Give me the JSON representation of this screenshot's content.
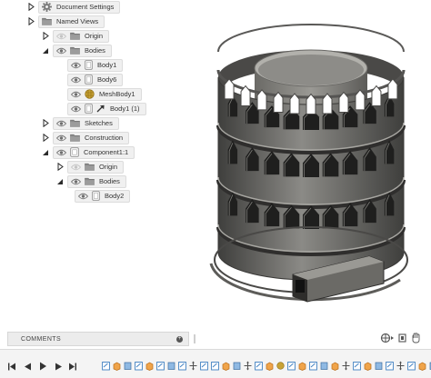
{
  "browser": {
    "rows": [
      {
        "id": "document-settings",
        "label": "Document Settings",
        "indent": 0,
        "expand": "right",
        "icons": [
          "gear"
        ]
      },
      {
        "id": "named-views",
        "label": "Named Views",
        "indent": 0,
        "expand": "right",
        "icons": [
          "folder"
        ]
      },
      {
        "id": "origin",
        "label": "Origin",
        "indent": 1,
        "expand": "right",
        "icons": [
          "eye-off",
          "folder"
        ]
      },
      {
        "id": "bodies",
        "label": "Bodies",
        "indent": 1,
        "expand": "down",
        "icons": [
          "eye",
          "folder"
        ]
      },
      {
        "id": "body1",
        "label": "Body1",
        "indent": 2,
        "expand": "none",
        "icons": [
          "eye",
          "body"
        ]
      },
      {
        "id": "body6",
        "label": "Body6",
        "indent": 2,
        "expand": "none",
        "icons": [
          "eye",
          "body"
        ]
      },
      {
        "id": "meshbody1",
        "label": "MeshBody1",
        "indent": 2,
        "expand": "none",
        "icons": [
          "eye",
          "mesh"
        ]
      },
      {
        "id": "body1-1",
        "label": "Body1 (1)",
        "indent": 2,
        "expand": "none",
        "icons": [
          "eye",
          "body",
          "arrow"
        ]
      },
      {
        "id": "sketches",
        "label": "Sketches",
        "indent": 1,
        "expand": "right",
        "icons": [
          "eye",
          "folder"
        ]
      },
      {
        "id": "construction",
        "label": "Construction",
        "indent": 1,
        "expand": "right",
        "icons": [
          "eye",
          "folder"
        ]
      },
      {
        "id": "component1",
        "label": "Component1:1",
        "indent": 1,
        "expand": "down",
        "icons": [
          "eye",
          "component"
        ]
      },
      {
        "id": "comp-origin",
        "label": "Origin",
        "indent": 2,
        "expand": "right",
        "icons": [
          "eye-off",
          "folder"
        ]
      },
      {
        "id": "comp-bodies",
        "label": "Bodies",
        "indent": 2,
        "expand": "down",
        "icons": [
          "eye",
          "folder"
        ]
      },
      {
        "id": "body2",
        "label": "Body2",
        "indent": 3,
        "expand": "none",
        "icons": [
          "eye",
          "body"
        ]
      }
    ]
  },
  "comments": {
    "title": "COMMENTS"
  },
  "colors": {
    "model": "#5a5a58",
    "model_dark": "#3f3f3d",
    "model_light": "#8b8a86"
  },
  "timeline": {
    "items": [
      "sketch",
      "extrude",
      "body",
      "sketch",
      "extrude",
      "sketch",
      "body",
      "sketch",
      "move",
      "sketch",
      "sketch",
      "extrude",
      "body",
      "move",
      "sketch",
      "extrude",
      "mesh",
      "sketch",
      "extrude",
      "sketch",
      "body",
      "extrude",
      "move",
      "sketch",
      "extrude",
      "body",
      "sketch",
      "move",
      "sketch",
      "extrude",
      "body",
      "sketch"
    ]
  }
}
